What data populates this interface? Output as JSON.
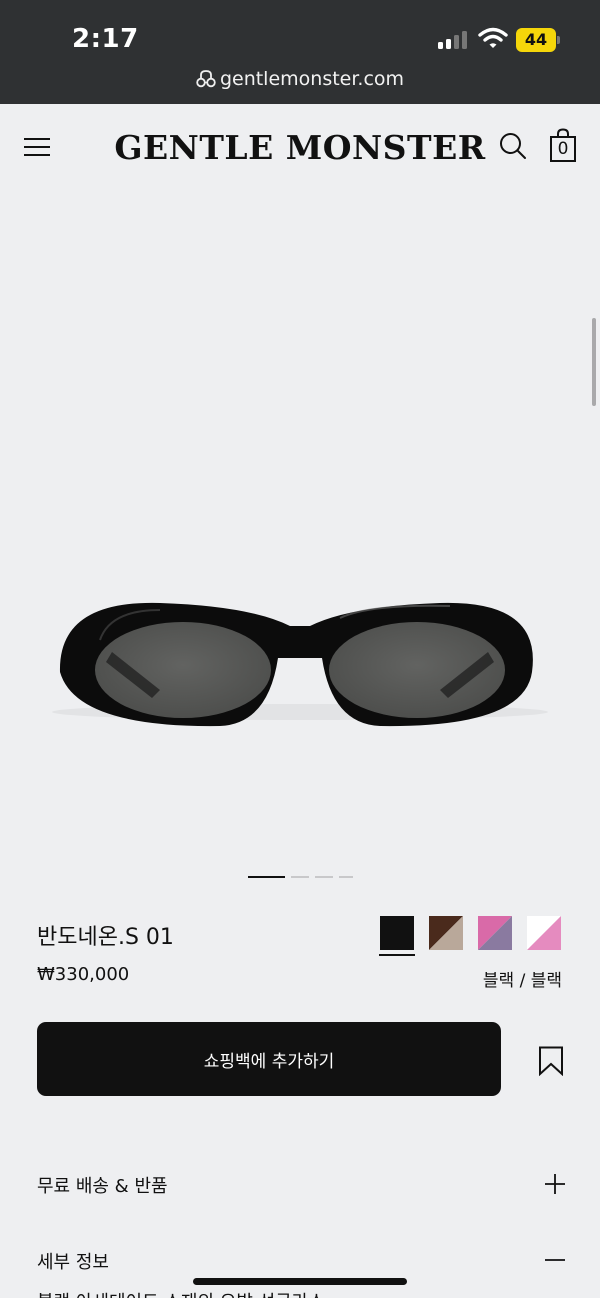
{
  "status_bar": {
    "time": "2:17",
    "battery": "44",
    "battery_color": "#f5d60a"
  },
  "browser": {
    "url": "gentlemonster.com"
  },
  "header": {
    "logo": "GENTLE MONSTER",
    "bag_count": "0"
  },
  "product": {
    "name": "반도네온.S 01",
    "price": "₩330,000",
    "selected_color": "블랙 / 블랙",
    "swatches": [
      {
        "name": "black",
        "colors": [
          "#111111",
          "#111111"
        ],
        "selected": true
      },
      {
        "name": "brown",
        "colors": [
          "#4a2a1c",
          "#b9a89a"
        ],
        "selected": false
      },
      {
        "name": "pink-purple",
        "colors": [
          "#d96aa8",
          "#8a7aa0"
        ],
        "selected": false
      },
      {
        "name": "white-pink",
        "colors": [
          "#ffffff",
          "#e58bbf"
        ],
        "selected": false
      }
    ]
  },
  "carousel": {
    "total": 4,
    "active": 1
  },
  "actions": {
    "add_to_bag": "쇼핑백에 추가하기"
  },
  "accordion": [
    {
      "label": "무료 배송 & 반품",
      "state": "collapsed"
    },
    {
      "label": "세부 정보",
      "state": "expanded"
    }
  ],
  "detail_peek": "블랙 아세테이트 소재의 오발 선글라스"
}
